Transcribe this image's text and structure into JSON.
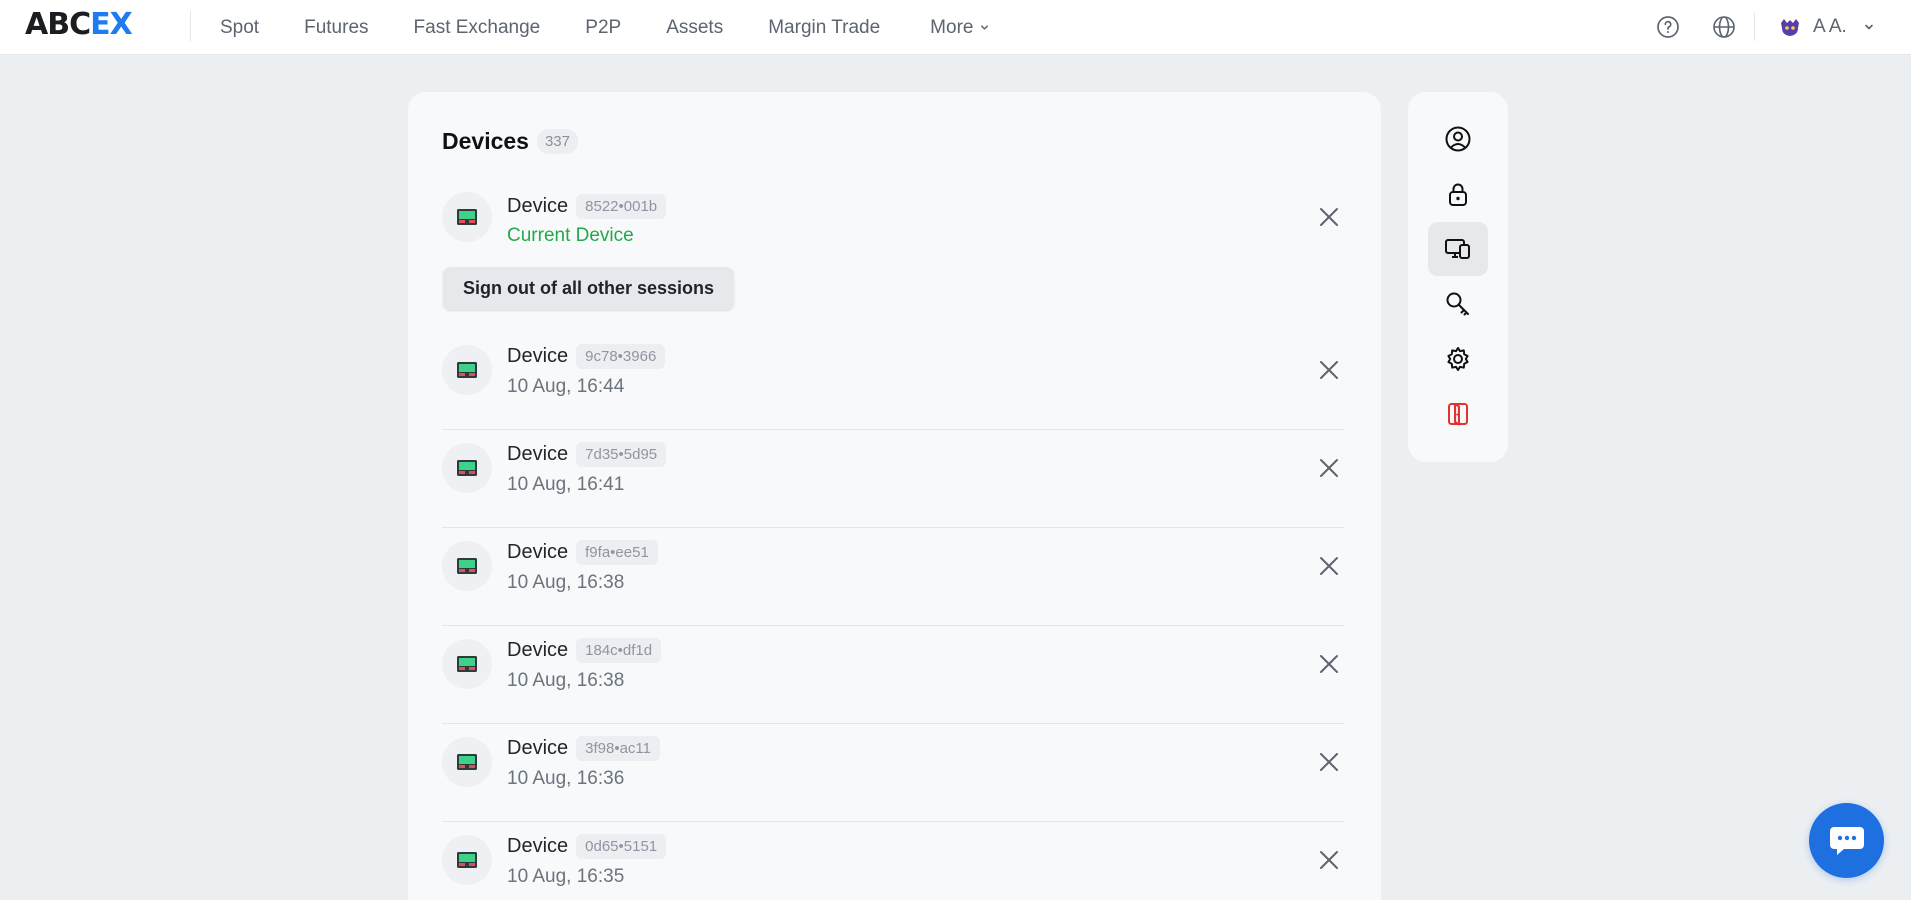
{
  "brand": {
    "logo_part1": "ABC",
    "logo_part2": "EX",
    "accent": "#1e7cf2"
  },
  "nav": {
    "items": [
      {
        "label": "Spot"
      },
      {
        "label": "Futures"
      },
      {
        "label": "Fast Exchange"
      },
      {
        "label": "P2P"
      },
      {
        "label": "Assets"
      },
      {
        "label": "Margin Trade"
      },
      {
        "label": "More"
      }
    ]
  },
  "topbar": {
    "user_name": "A A.",
    "icons": [
      "help-icon",
      "globe-icon",
      "avatar-icon",
      "chevron-down-icon"
    ]
  },
  "devices": {
    "title": "Devices",
    "count": "337",
    "signout_label": "Sign out of all other sessions",
    "current": {
      "name": "Device",
      "id": "8522•001b",
      "status": "Current Device",
      "status_color": "#22a94a"
    },
    "list": [
      {
        "name": "Device",
        "id": "9c78•3966",
        "time": "10 Aug, 16:44"
      },
      {
        "name": "Device",
        "id": "7d35•5d95",
        "time": "10 Aug, 16:41"
      },
      {
        "name": "Device",
        "id": "f9fa•ee51",
        "time": "10 Aug, 16:38"
      },
      {
        "name": "Device",
        "id": "184c•df1d",
        "time": "10 Aug, 16:38"
      },
      {
        "name": "Device",
        "id": "3f98•ac11",
        "time": "10 Aug, 16:36"
      },
      {
        "name": "Device",
        "id": "0d65•5151",
        "time": "10 Aug, 16:35"
      }
    ]
  },
  "sidemenu": {
    "items": [
      "profile-icon",
      "lock-icon",
      "devices-icon",
      "key-icon",
      "settings-icon",
      "logout-icon"
    ],
    "active": "devices-icon",
    "logout_color": "#e0332f"
  },
  "chat": {
    "icon": "chat-icon",
    "color": "#1e6fe0"
  }
}
